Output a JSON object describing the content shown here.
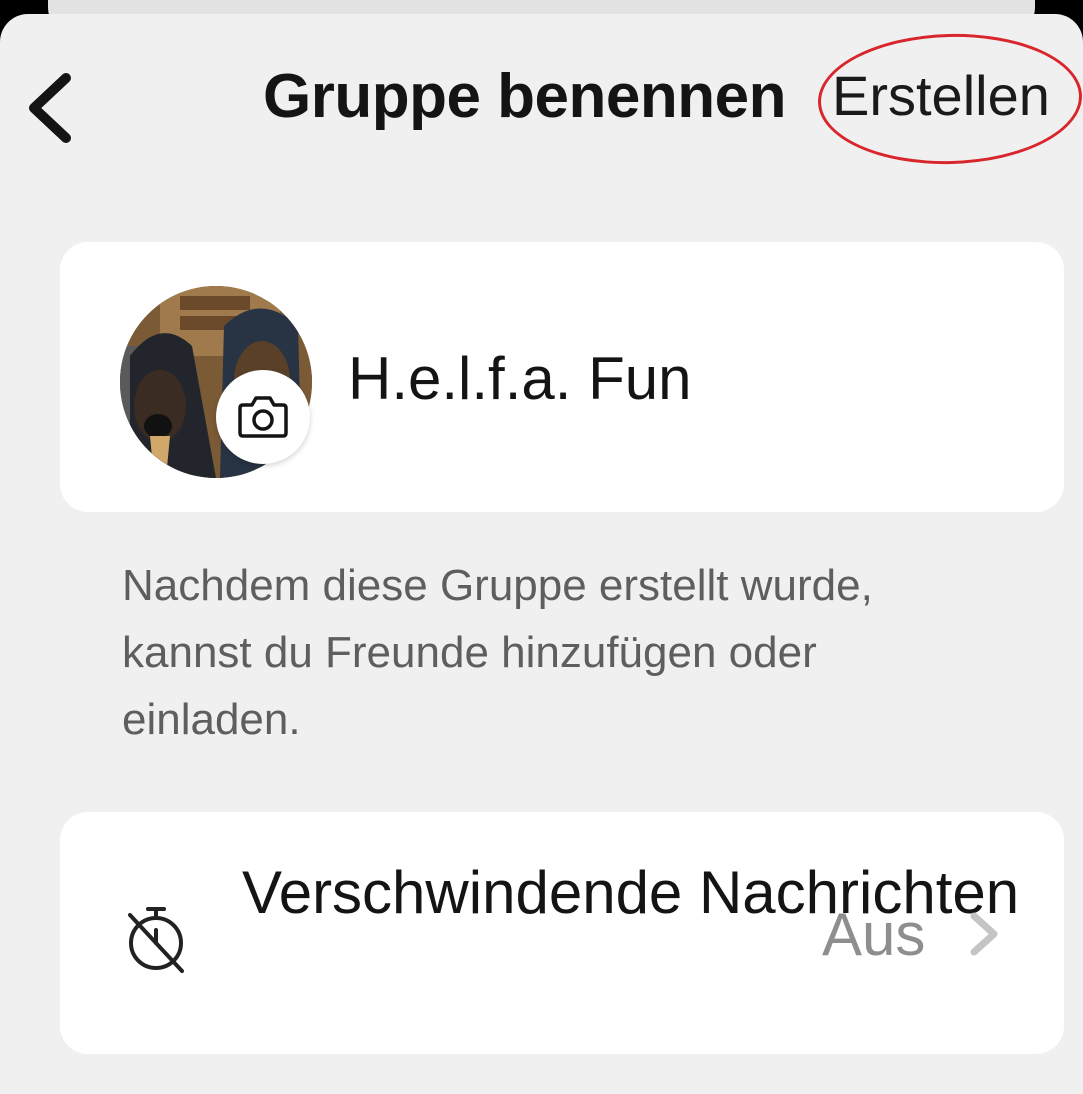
{
  "header": {
    "title": "Gruppe benennen",
    "create_label": "Erstellen",
    "back_icon": "chevron-left-icon"
  },
  "group": {
    "name": "H.e.l.f.a. Fun",
    "camera_icon": "camera-icon"
  },
  "hint_text": "Nachdem diese Gruppe erstellt wurde, kannst du Freunde hinzufügen oder einladen.",
  "settings": {
    "disappearing_messages": {
      "label": "Verschwindende Nachrichten",
      "value": "Aus",
      "icon": "timer-off-icon"
    }
  },
  "colors": {
    "annotation": "#d8262c",
    "sheet_background": "#f0f0f0",
    "card_background": "#ffffff",
    "muted_text": "#8e8e8e"
  }
}
